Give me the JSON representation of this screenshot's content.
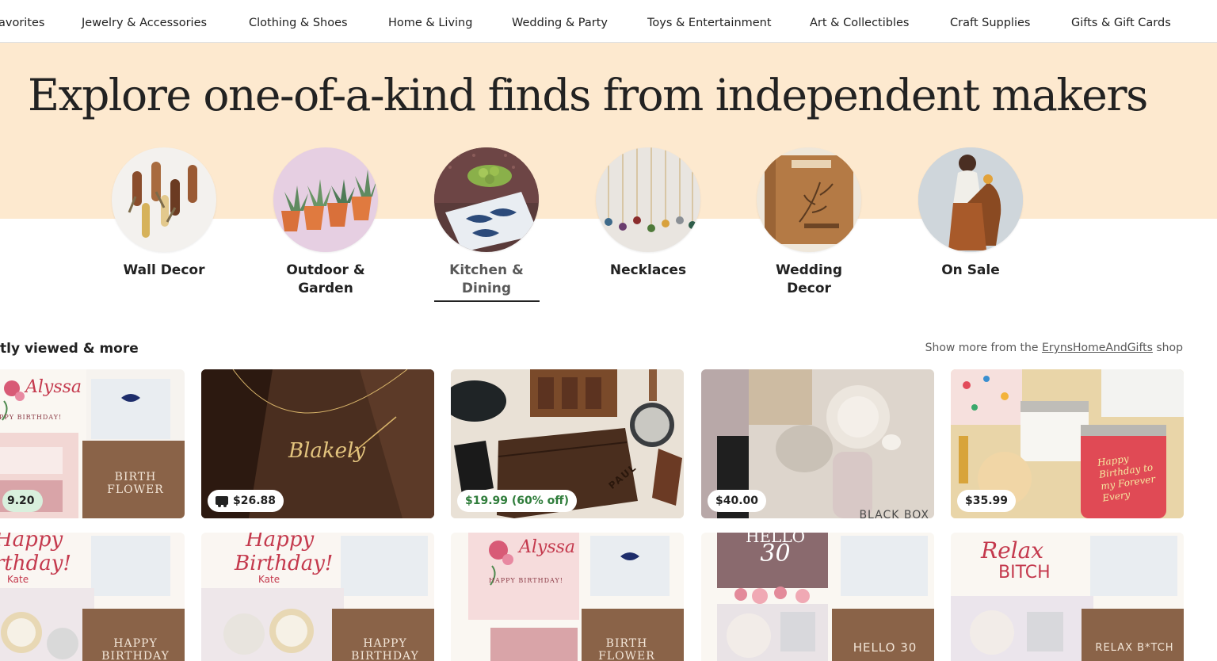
{
  "nav": {
    "categories": [
      "avorites",
      "Jewelry & Accessories",
      "Clothing & Shoes",
      "Home & Living",
      "Wedding & Party",
      "Toys & Entertainment",
      "Art & Collectibles",
      "Craft Supplies",
      "Gifts & Gift Cards"
    ]
  },
  "hero": {
    "title": "Explore one-of-a-kind finds from independent makers",
    "background": "#fde9cf"
  },
  "circles": [
    {
      "label": "Wall Decor",
      "active": false
    },
    {
      "label_line1": "Outdoor &",
      "label_line2": "Garden",
      "active": false
    },
    {
      "label_line1": "Kitchen &",
      "label_line2": "Dining",
      "active": true
    },
    {
      "label": "Necklaces",
      "active": false
    },
    {
      "label_line1": "Wedding",
      "label_line2": "Decor",
      "active": false
    },
    {
      "label": "On Sale",
      "active": false
    }
  ],
  "section": {
    "title": "tly viewed & more",
    "link_prefix": "Show more from the ",
    "shop_name": "ErynsHomeAndGifts",
    "link_suffix": " shop"
  },
  "listings_row1": [
    {
      "price": "9.20",
      "image_text_top": "Alyssa",
      "image_text_small": "PPY BIRTHDAY!",
      "panel_text": "BIRTH FLOWER"
    },
    {
      "price": "$26.88",
      "free_shipping": true,
      "image_text": "Blakely"
    },
    {
      "price": "$19.99 (60% off)",
      "on_sale": true,
      "image_text": "PAUL"
    },
    {
      "price": "$40.00",
      "image_text": "BLACK BOX"
    },
    {
      "price": "$35.99",
      "image_text": "Happy Birthday to my Forever Every"
    }
  ],
  "listings_row2": [
    {
      "script": "Happy",
      "script2": "rthday!",
      "name": "Kate",
      "panel_text": "HAPPY BIRTHDAY"
    },
    {
      "script": "Happy",
      "script2": "Birthday!",
      "name": "Kate",
      "panel_text": "HAPPY BIRTHDAY"
    },
    {
      "script": "Alyssa",
      "small": "HAPPY BIRTHDAY!",
      "panel_text": "BIRTH FLOWER"
    },
    {
      "script": "HELLO",
      "script2": "30",
      "panel_text": "HELLO 30"
    },
    {
      "script": "Relax",
      "script2": "BITCH",
      "panel_text": "RELAX B*TCH"
    }
  ],
  "colors": {
    "accent_sale": "#2f7d3b",
    "panel_tan": "#8a6348",
    "script_red": "#c4394d"
  }
}
